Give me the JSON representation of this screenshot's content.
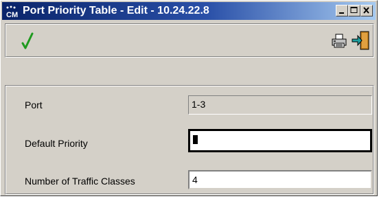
{
  "window": {
    "title": "Port Priority Table - Edit - 10.24.22.8",
    "app_icon_text": "CM",
    "controls": [
      "minimize-icon",
      "maximize-icon",
      "close-icon"
    ]
  },
  "toolbar": {
    "apply_icon": "checkmark-icon",
    "print_icon": "printer-icon",
    "exit_icon": "exit-door-icon"
  },
  "form": {
    "port": {
      "label": "Port",
      "value": "1-3"
    },
    "default_priority": {
      "label": "Default Priority",
      "value": "0"
    },
    "traffic_classes": {
      "label": "Number of Traffic Classes",
      "value": "4"
    }
  },
  "colors": {
    "title_bar_start": "#0a246a",
    "title_bar_end": "#a6caf0",
    "window_bg": "#d4d0c8",
    "check_green": "#1f9a1f"
  }
}
